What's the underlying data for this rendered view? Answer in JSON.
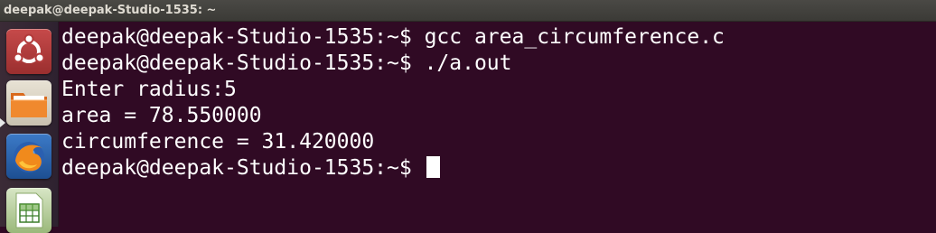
{
  "window": {
    "title": "deepak@deepak-Studio-1535: ~"
  },
  "launcher": {
    "items": [
      {
        "name": "Dash Home",
        "icon": "ubuntu-logo-icon"
      },
      {
        "name": "Files",
        "icon": "folder-icon",
        "active": true
      },
      {
        "name": "Firefox",
        "icon": "firefox-icon"
      },
      {
        "name": "LibreOffice Calc",
        "icon": "spreadsheet-icon"
      }
    ]
  },
  "terminal": {
    "lines": [
      "deepak@deepak-Studio-1535:~$ gcc area_circumference.c",
      "deepak@deepak-Studio-1535:~$ ./a.out",
      "Enter radius:5",
      "area = 78.550000",
      "circumference = 31.420000",
      "deepak@deepak-Studio-1535:~$ "
    ],
    "colors": {
      "background": "#300a24",
      "foreground": "#ffffff"
    }
  }
}
